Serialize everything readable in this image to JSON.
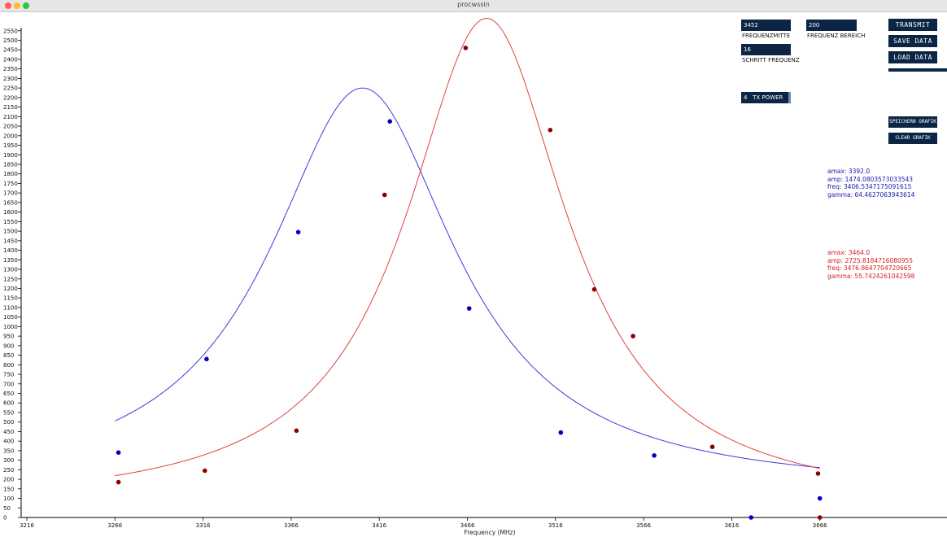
{
  "window": {
    "title": "procwssin"
  },
  "controls": {
    "freq_center": {
      "value": "3452",
      "label": "FREQUENZMITTE"
    },
    "freq_range": {
      "value": "200",
      "label": "FREQUENZ BEREICH"
    },
    "step_freq": {
      "value": "16",
      "label": "SCHRITT FREQUENZ"
    },
    "tx_power": {
      "value": "4",
      "label": "TX POWER"
    },
    "transmit_label": "TRANSMIT",
    "save_label": "SAVE DATA",
    "load_label": "LOAD DATA",
    "save_graph_label": "SPEICHERN GRAFIK",
    "clear_graph_label": "CLEAR GRAFIK"
  },
  "fit_blue": {
    "amax": "amax: 3392.0",
    "amp": "amp: 1474.0803573033543",
    "freq": "freq: 3406.5347175091615",
    "gamma": "gamma: 64.4627063943614"
  },
  "fit_red": {
    "amax": "amax: 3464.0",
    "amp": "amp: 2725.8184716080955",
    "freq": "freq: 3476.8647704720665",
    "gamma": "gamma: 55.7424261042598"
  },
  "colors": {
    "blue": "#3a3ae0",
    "red": "#e04040",
    "blue_dot": "#0000cc",
    "red_dot": "#8b0000",
    "button_bg": "#0b2545"
  },
  "chart_data": {
    "type": "scatter",
    "xlabel": "Frequency (MHz)",
    "ylabel": "",
    "xlim": [
      3216,
      3716
    ],
    "ylim": [
      0,
      2600
    ],
    "x_ticks": [
      3216,
      3266,
      3316,
      3366,
      3416,
      3466,
      3516,
      3566,
      3616,
      3666
    ],
    "y_ticks": [
      0,
      50,
      100,
      150,
      200,
      250,
      300,
      350,
      400,
      450,
      500,
      550,
      600,
      650,
      700,
      750,
      800,
      850,
      900,
      950,
      1000,
      1050,
      1100,
      1150,
      1200,
      1250,
      1300,
      1350,
      1400,
      1450,
      1500,
      1550,
      1600,
      1650,
      1700,
      1750,
      1800,
      1850,
      1900,
      1950,
      2000,
      2050,
      2100,
      2150,
      2200,
      2250,
      2300,
      2350,
      2400,
      2450,
      2500,
      2550
    ],
    "series": [
      {
        "color": "blue",
        "points": [
          [
            3268,
            340
          ],
          [
            3318,
            830
          ],
          [
            3370,
            1495
          ],
          [
            3422,
            2075
          ],
          [
            3467,
            1095
          ],
          [
            3519,
            445
          ],
          [
            3572,
            325
          ],
          [
            3627,
            0
          ],
          [
            3666,
            100
          ]
        ],
        "curve": {
          "x_from": 3266,
          "x_to": 3666,
          "peak_x": 3406.5,
          "peak_y": 2250,
          "base_y": 330,
          "gamma": 64.46
        }
      },
      {
        "color": "red",
        "points": [
          [
            3268,
            185
          ],
          [
            3317,
            245
          ],
          [
            3369,
            455
          ],
          [
            3419,
            1690
          ],
          [
            3465,
            2460
          ],
          [
            3513,
            2030
          ],
          [
            3538,
            1195
          ],
          [
            3560,
            950
          ],
          [
            3605,
            370
          ],
          [
            3665,
            230
          ],
          [
            3666,
            0
          ]
        ],
        "curve": {
          "x_from": 3266,
          "x_to": 3666,
          "peak_x": 3476.9,
          "peak_y": 2615,
          "base_y": 200,
          "gamma": 55.74
        }
      }
    ]
  }
}
